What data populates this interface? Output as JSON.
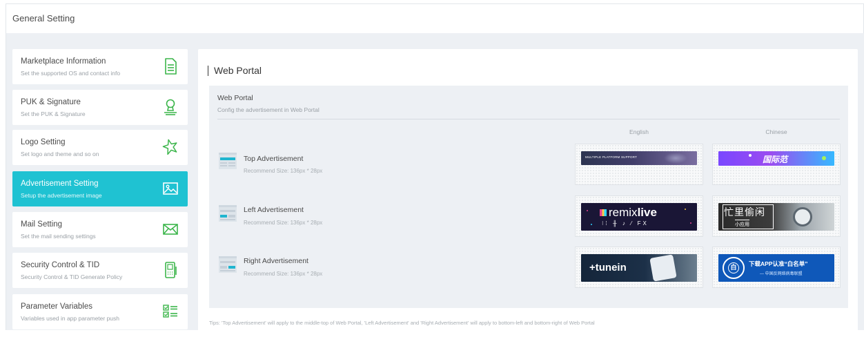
{
  "header": {
    "title": "General Setting"
  },
  "sidebar": {
    "items": [
      {
        "label": "Marketplace Information",
        "desc": "Set the supported OS and contact info",
        "icon": "document-icon",
        "active": false
      },
      {
        "label": "PUK & Signature",
        "desc": "Set the PUK & Signature",
        "icon": "stamp-icon",
        "active": false
      },
      {
        "label": "Logo Setting",
        "desc": "Set logo and theme and so on",
        "icon": "star-icon",
        "active": false
      },
      {
        "label": "Advertisement Setting",
        "desc": "Setup the advertisement image",
        "icon": "image-icon",
        "active": true
      },
      {
        "label": "Mail Setting",
        "desc": "Set the mail sending settings",
        "icon": "mail-icon",
        "active": false
      },
      {
        "label": "Security Control & TID",
        "desc": "Security Control & TID Generate Policy",
        "icon": "terminal-icon",
        "active": false
      },
      {
        "label": "Parameter Variables",
        "desc": "Variables used in app parameter push",
        "icon": "checklist-icon",
        "active": false
      }
    ]
  },
  "main": {
    "title": "Web Portal",
    "section": {
      "title": "Web Portal",
      "desc": "Config the advertisement in Web Portal",
      "columns": {
        "english": "English",
        "chinese": "Chinese"
      },
      "ads": [
        {
          "label": "Top Advertisement",
          "size": "Recommend Size: 136px * 28px",
          "english_banner": {
            "text": "MULTIPLE PLATFORM SUPPORT"
          },
          "chinese_banner": {
            "text": "国际范"
          }
        },
        {
          "label": "Left Advertisement",
          "size": "Recommend Size: 136px * 28px",
          "english_banner": {
            "text_light": "remix",
            "text_bold": "live",
            "sub": "FX"
          },
          "chinese_banner": {
            "text": "忙里偷闲",
            "sub": "小应用"
          }
        },
        {
          "label": "Right Advertisement",
          "size": "Recommend Size: 136px * 28px",
          "english_banner": {
            "text": "+tunein"
          },
          "chinese_banner": {
            "seal": "白",
            "text": "下载APP认准“白名单”",
            "sub": "— 中国反网络病毒联盟"
          }
        }
      ]
    },
    "tips": "Tips: 'Top Advertisement' will apply to the middle-top of Web Portal, 'Left Advertisement' and 'Right Advertisement' will apply to bottom-left and bottom-right of Web Portal"
  },
  "colors": {
    "accent": "#1fc2d2",
    "icon_green": "#3bb54a",
    "background": "#edf0f4"
  }
}
